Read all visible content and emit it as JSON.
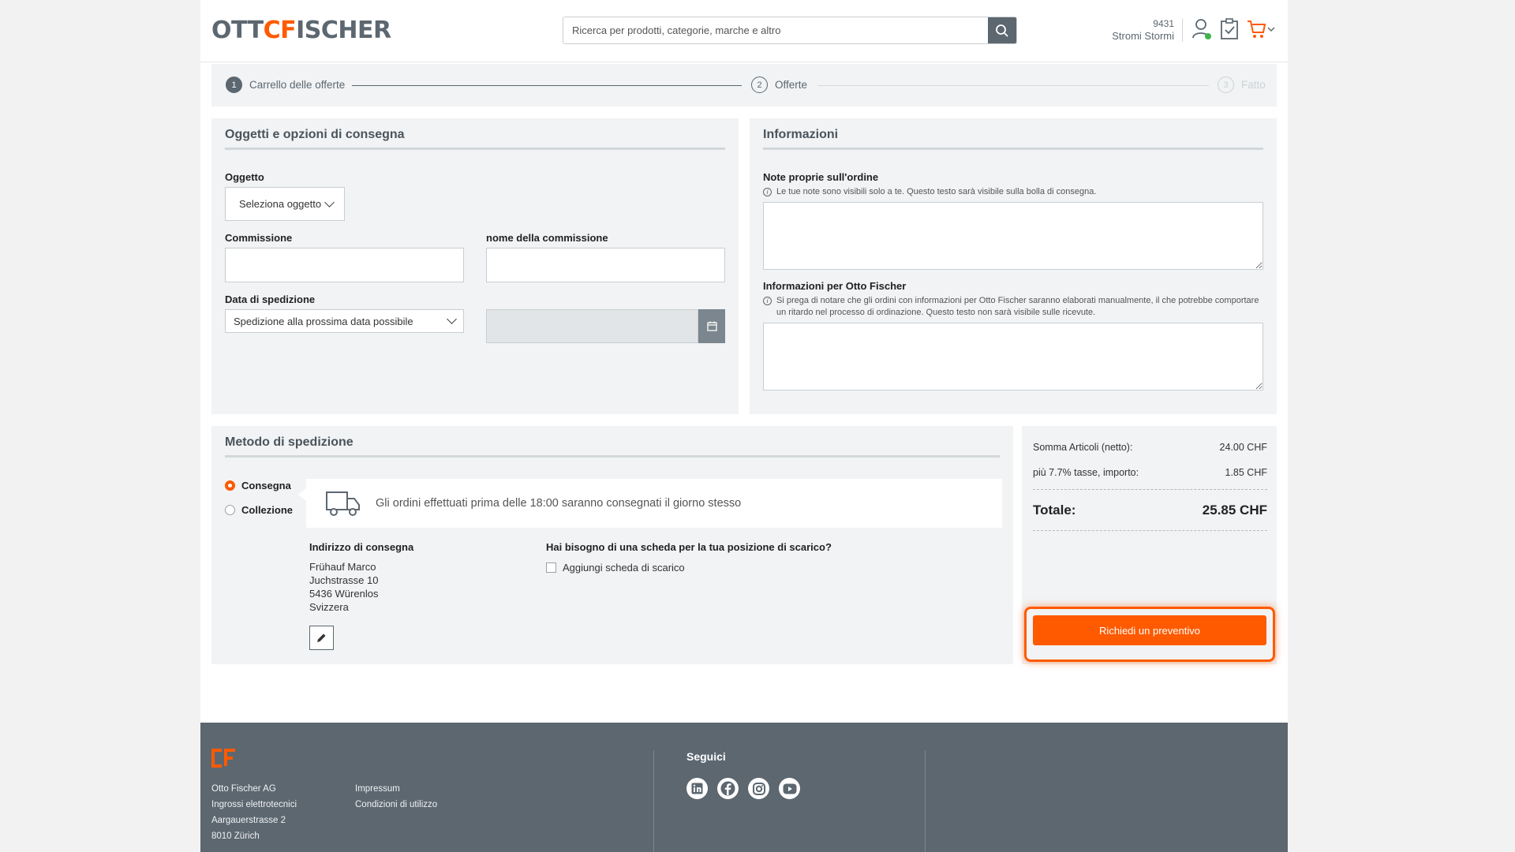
{
  "header": {
    "logo": {
      "part1": "OTT",
      "part2": "CF",
      "part3": "ISCHER"
    },
    "search_placeholder": "Ricerca per prodotti, categorie, marche e altro",
    "user_number": "9431",
    "user_name": "Stromi Stormi"
  },
  "stepper": {
    "steps": [
      {
        "number": "1",
        "label": "Carrello delle offerte"
      },
      {
        "number": "2",
        "label": "Offerte"
      },
      {
        "number": "3",
        "label": "Fatto"
      }
    ]
  },
  "delivery_card": {
    "title": "Oggetti e opzioni di consegna",
    "object_label": "Oggetto",
    "object_select": "Seleziona oggetto",
    "commission_label": "Commissione",
    "commission_name_label": "nome della commissione",
    "ship_date_label": "Data di spedizione",
    "ship_date_select": "Spedizione alla prossima data possibile"
  },
  "info_card": {
    "title": "Informazioni",
    "notes_label": "Note proprie sull'ordine",
    "notes_hint": "Le tue note sono visibili solo a te. Questo testo sarà visibile sulla bolla di consegna.",
    "otto_label": "Informazioni per Otto Fischer",
    "otto_hint": "Si prega di notare che gli ordini con informazioni per Otto Fischer saranno elaborati manualmente, il che potrebbe comportare un ritardo nel processo di ordinazione. Questo testo non sarà visibile sulle ricevute."
  },
  "shipping_card": {
    "title": "Metodo di spedizione",
    "option_delivery": "Consegna",
    "option_pickup": "Collezione",
    "notice": "Gli ordini effettuati prima delle 18:00 saranno consegnati il giorno stesso",
    "address_label": "Indirizzo di consegna",
    "address_lines": [
      "Frühauf Marco",
      "Juchstrasse 10",
      "5436 Würenlos",
      "Svizzera"
    ],
    "unload_label": "Hai bisogno di una scheda per la tua posizione di scarico?",
    "unload_checkbox": "Aggiungi scheda di scarico"
  },
  "summary": {
    "items_label": "Somma Articoli (netto):",
    "items_value": "24.00 CHF",
    "tax_label": "più 7.7% tasse, importo:",
    "tax_value": "1.85 CHF",
    "total_label": "Totale:",
    "total_value": "25.85 CHF",
    "cta": "Richiedi un preventivo"
  },
  "footer": {
    "company": [
      "Otto Fischer AG",
      "Ingrossi elettrotecnici",
      "Aargauerstrasse 2",
      "8010 Zürich"
    ],
    "links": [
      "Impressum",
      "Condizioni di utilizzo"
    ],
    "follow": "Seguici"
  },
  "colors": {
    "accent": "#ff5a00",
    "slate": "#5c6770",
    "panel": "#f1f3f4"
  }
}
